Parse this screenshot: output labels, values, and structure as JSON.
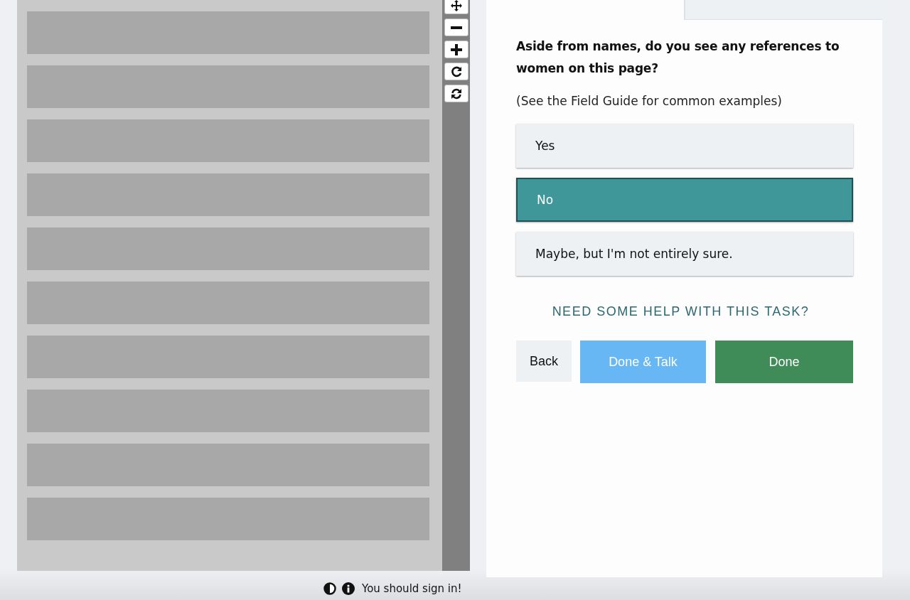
{
  "tabs": [
    {
      "selected": true
    },
    {
      "selected": false
    }
  ],
  "image_tools": [
    {
      "kind": "move"
    },
    {
      "kind": "zoom-out"
    },
    {
      "kind": "zoom-in"
    },
    {
      "kind": "rotate"
    },
    {
      "kind": "reset"
    }
  ],
  "question": "Aside from names, do you see any references to women on this page?",
  "hint": "(See the Field Guide for common examples)",
  "answers": [
    {
      "label": "Yes",
      "selected": false
    },
    {
      "label": "No",
      "selected": true
    },
    {
      "label": "Maybe, but I'm not entirely sure.",
      "selected": false
    }
  ],
  "help_link": "NEED SOME HELP WITH THIS TASK?",
  "buttons": [
    {
      "kind": "back",
      "label": "Back"
    },
    {
      "kind": "talk",
      "label": "Done & Talk"
    },
    {
      "kind": "done",
      "label": "Done"
    }
  ],
  "footer": {
    "message": "You should sign in!"
  }
}
